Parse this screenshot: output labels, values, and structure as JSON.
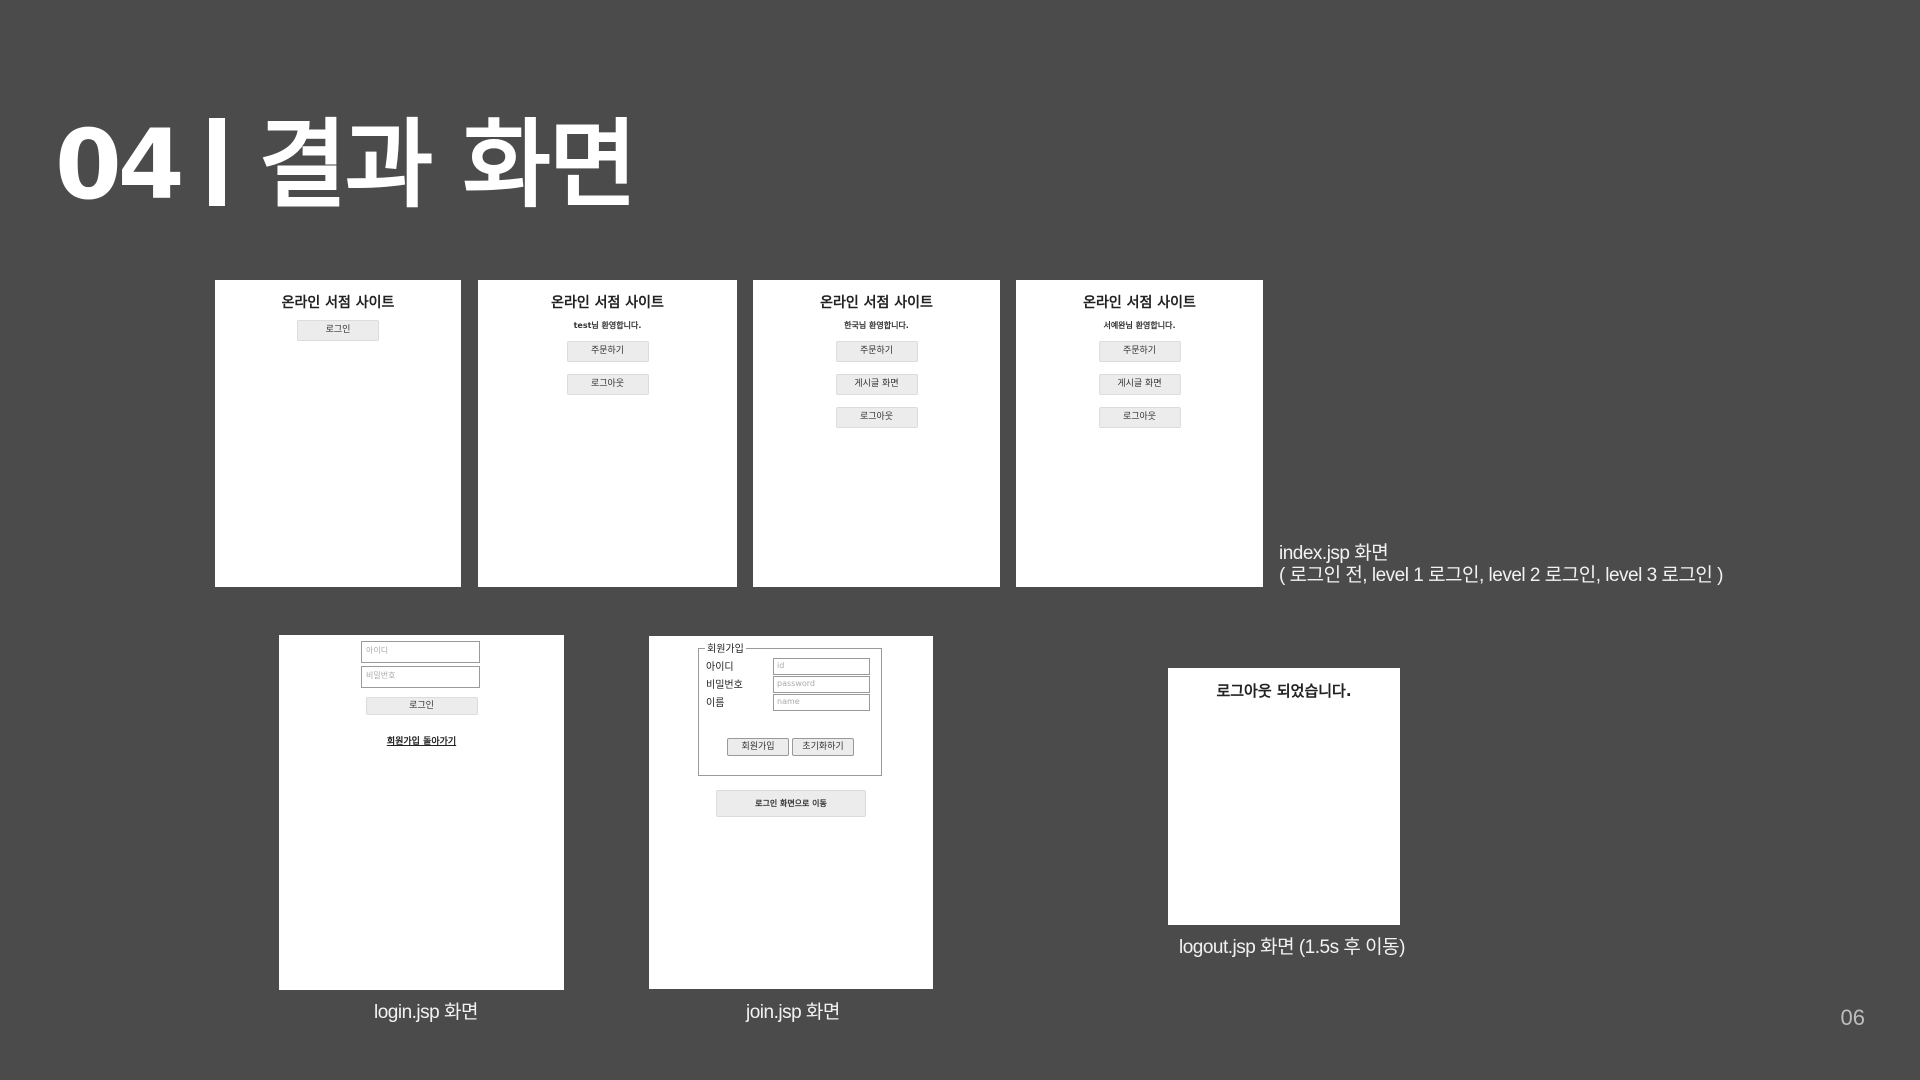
{
  "slide": {
    "number": "04",
    "title": "결과 화면",
    "page_num": "06"
  },
  "index_screens": [
    {
      "title": "온라인 서점 사이트",
      "welcome": "",
      "buttons": [
        "로그인"
      ]
    },
    {
      "title": "온라인 서점 사이트",
      "welcome": "test님 환영합니다.",
      "buttons": [
        "주문하기",
        "로그아웃"
      ]
    },
    {
      "title": "온라인 서점 사이트",
      "welcome": "한국님 환영합니다.",
      "buttons": [
        "주문하기",
        "게시글 화면",
        "로그아웃"
      ]
    },
    {
      "title": "온라인 서점 사이트",
      "welcome": "서예완님 환영합니다.",
      "buttons": [
        "주문하기",
        "게시글 화면",
        "로그아웃"
      ]
    }
  ],
  "captions": {
    "index_line1": "index.jsp 화면",
    "index_line2": "( 로그인 전, level 1 로그인, level 2 로그인, level 3 로그인 )",
    "login": "login.jsp 화면",
    "join": "join.jsp 화면",
    "logout": "logout.jsp 화면 (1.5s 후 이동)"
  },
  "login_screen": {
    "id_placeholder": "아이디",
    "pw_placeholder": "비밀번호",
    "login_button": "로그인",
    "links": "회원가입 돌아가기"
  },
  "join_screen": {
    "legend": "회원가입",
    "label_id": "아이디",
    "label_pw": "비밀번호",
    "label_name": "이름",
    "ph_id": "id",
    "ph_pw": "password",
    "ph_name": "name",
    "join_button": "회원가입",
    "reset_button": "초기화하기",
    "go_login_button": "로그인 화면으로 이동"
  },
  "logout_screen": {
    "message": "로그아웃 되었습니다."
  }
}
